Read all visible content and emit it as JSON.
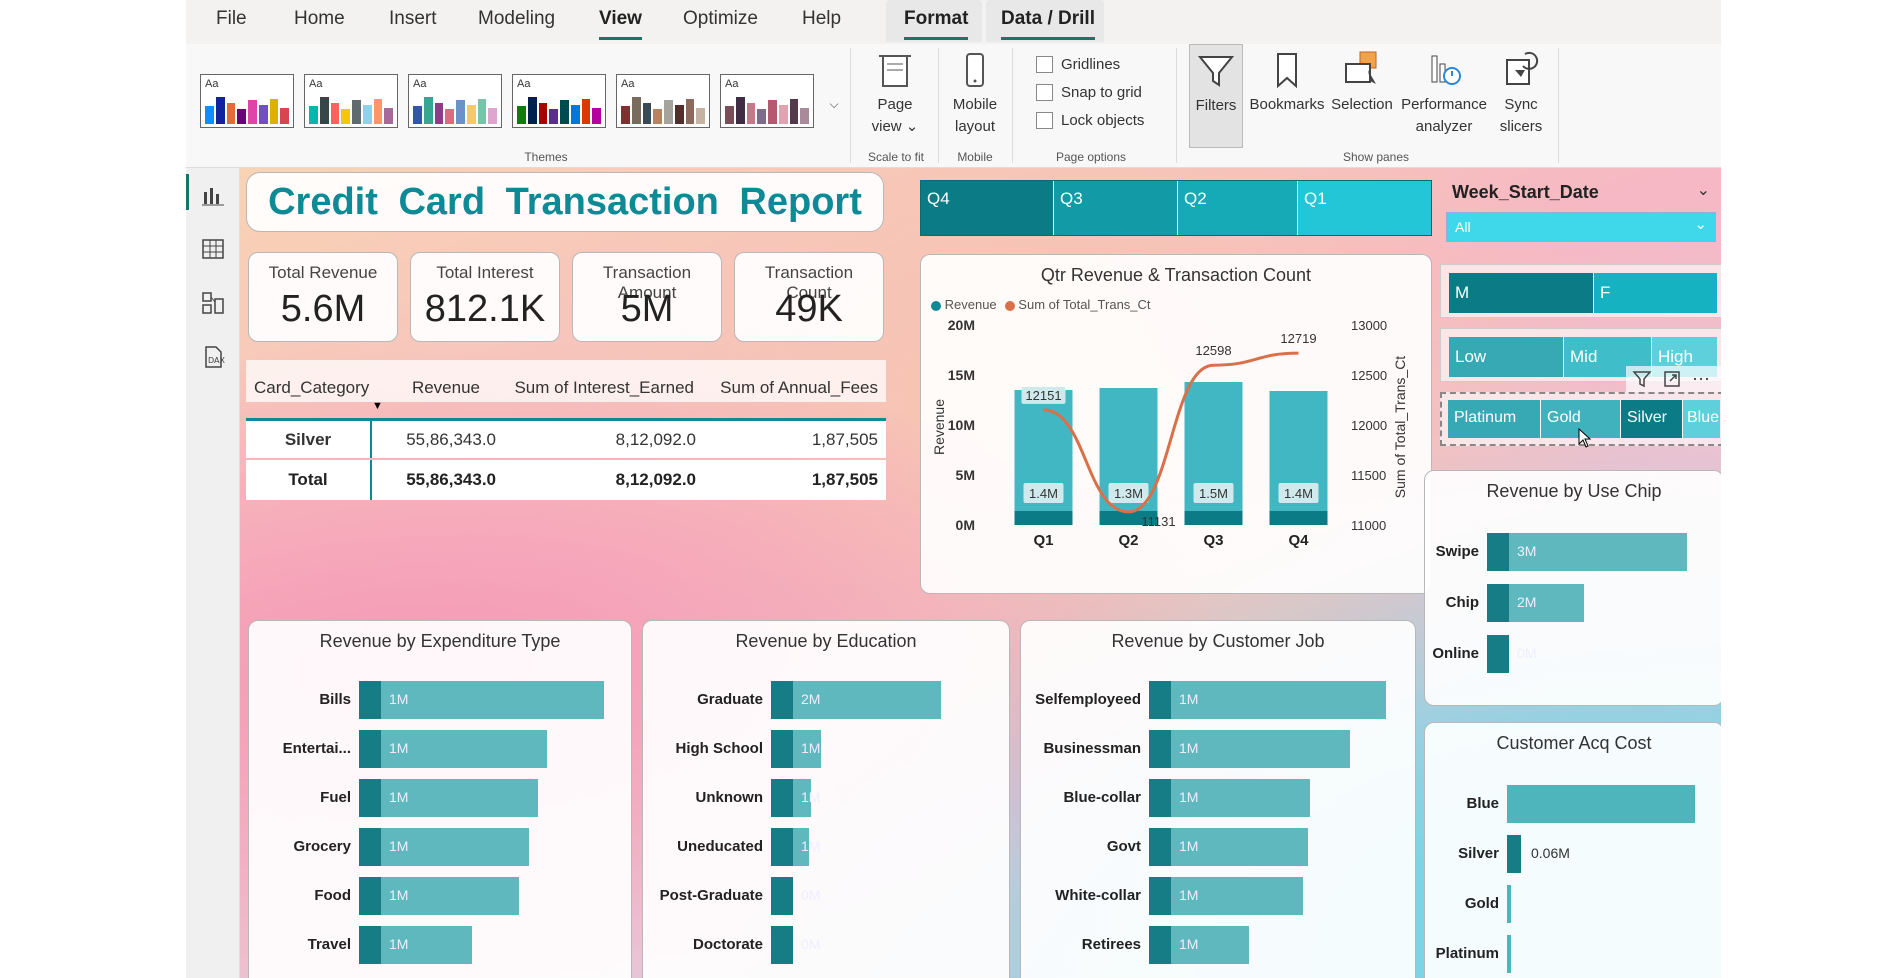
{
  "menu": {
    "items": [
      "File",
      "Home",
      "Insert",
      "Modeling",
      "View",
      "Optimize",
      "Help",
      "Format",
      "Data / Drill"
    ],
    "active": "View"
  },
  "ribbon": {
    "themes_label": "Themes",
    "theme_aa": "Aa",
    "page_view": "Page view",
    "scale_to_fit": "Scale to fit",
    "mobile_layout": "Mobile layout",
    "mobile": "Mobile",
    "gridlines": "Gridlines",
    "snap": "Snap to grid",
    "lock": "Lock objects",
    "page_options": "Page options",
    "filters": "Filters",
    "bookmarks": "Bookmarks",
    "selection": "Selection",
    "performance": "Performance analyzer",
    "sync": "Sync slicers",
    "show_panes": "Show panes"
  },
  "report": {
    "title": "Credit Card Transaction Report"
  },
  "kpis": [
    {
      "label": "Total Revenue",
      "value": "5.6M"
    },
    {
      "label": "Total Interest",
      "value": "812.1K"
    },
    {
      "label": "Transaction Amount",
      "value": "5M"
    },
    {
      "label": "Transaction Count",
      "value": "49K"
    }
  ],
  "table": {
    "headers": [
      "Card_Category",
      "Revenue",
      "Sum of Interest_Earned",
      "Sum of Annual_Fees"
    ],
    "rows": [
      [
        "Silver",
        "55,86,343.0",
        "8,12,092.0",
        "1,87,505"
      ]
    ],
    "total": [
      "Total",
      "55,86,343.0",
      "8,12,092.0",
      "1,87,505"
    ]
  },
  "quarter_slicer": [
    "Q4",
    "Q3",
    "Q2",
    "Q1"
  ],
  "week_slicer": {
    "title": "Week_Start_Date",
    "value": "All"
  },
  "gender_slicer": [
    "M",
    "F"
  ],
  "income_slicer": [
    "Low",
    "Mid",
    "High"
  ],
  "card_slicer": [
    "Platinum",
    "Gold",
    "Silver",
    "Blue"
  ],
  "colors": {
    "teal": "#0c8a96",
    "teal_dark": "#167d86",
    "teal_bar": "#5fb8be",
    "line": "#d9704a",
    "accent": "#117865"
  },
  "chart_data": [
    {
      "type": "bar+line",
      "title": "Qtr Revenue & Transaction Count",
      "legend": [
        "Revenue",
        "Sum of Total_Trans_Ct"
      ],
      "categories": [
        "Q1",
        "Q2",
        "Q3",
        "Q4"
      ],
      "series": [
        {
          "name": "Revenue",
          "values": [
            1400000,
            1300000,
            1500000,
            1400000
          ],
          "labels": [
            "1.4M",
            "1.3M",
            "1.5M",
            "1.4M"
          ]
        },
        {
          "name": "Sum of Total_Trans_Ct",
          "values": [
            12151,
            11131,
            12598,
            12719
          ],
          "labels": [
            "12151",
            "11131",
            "12598",
            "12719"
          ]
        }
      ],
      "ylabel": "Revenue",
      "y2label": "Sum of Total_Trans_Ct",
      "yticks": [
        "20M",
        "15M",
        "10M",
        "5M",
        "0M"
      ],
      "y2ticks": [
        "13000",
        "12500",
        "12000",
        "11500",
        "11000"
      ],
      "y2lim": [
        11000,
        13000
      ]
    },
    {
      "type": "bar",
      "title": "Revenue by Expenditure Type",
      "categories": [
        "Bills",
        "Entertai...",
        "Fuel",
        "Grocery",
        "Food",
        "Travel"
      ],
      "values": [
        1.3,
        1.0,
        0.95,
        0.9,
        0.85,
        0.6
      ],
      "labels": [
        "1M",
        "1M",
        "1M",
        "1M",
        "1M",
        "1M"
      ]
    },
    {
      "type": "bar",
      "title": "Revenue by Education",
      "categories": [
        "Graduate",
        "High School",
        "Unknown",
        "Uneducated",
        "Post-Graduate",
        "Doctorate"
      ],
      "values": [
        1.7,
        0.5,
        0.4,
        0.38,
        0.2,
        0.18
      ],
      "labels": [
        "2M",
        "1M",
        "1M",
        "1M",
        "0M",
        "0M"
      ]
    },
    {
      "type": "bar",
      "title": "Revenue by Customer Job",
      "categories": [
        "Selfemployeed",
        "Businessman",
        "Blue-collar",
        "Govt",
        "White-collar",
        "Retirees"
      ],
      "values": [
        1.0,
        0.85,
        0.68,
        0.67,
        0.65,
        0.42
      ],
      "labels": [
        "1M",
        "1M",
        "1M",
        "1M",
        "1M",
        "1M"
      ]
    },
    {
      "type": "bar",
      "title": "Revenue by Use Chip",
      "categories": [
        "Swipe",
        "Chip",
        "Online"
      ],
      "values": [
        3.5,
        1.7,
        0.3
      ],
      "labels": [
        "3M",
        "2M",
        "0M"
      ]
    },
    {
      "type": "bar",
      "title": "Customer Acq Cost",
      "categories": [
        "Blue",
        "Silver",
        "Gold",
        "Platinum"
      ],
      "values": [
        1.0,
        0.06,
        0.01,
        0.005
      ],
      "labels": [
        "",
        "0.06M",
        "",
        ""
      ]
    }
  ]
}
